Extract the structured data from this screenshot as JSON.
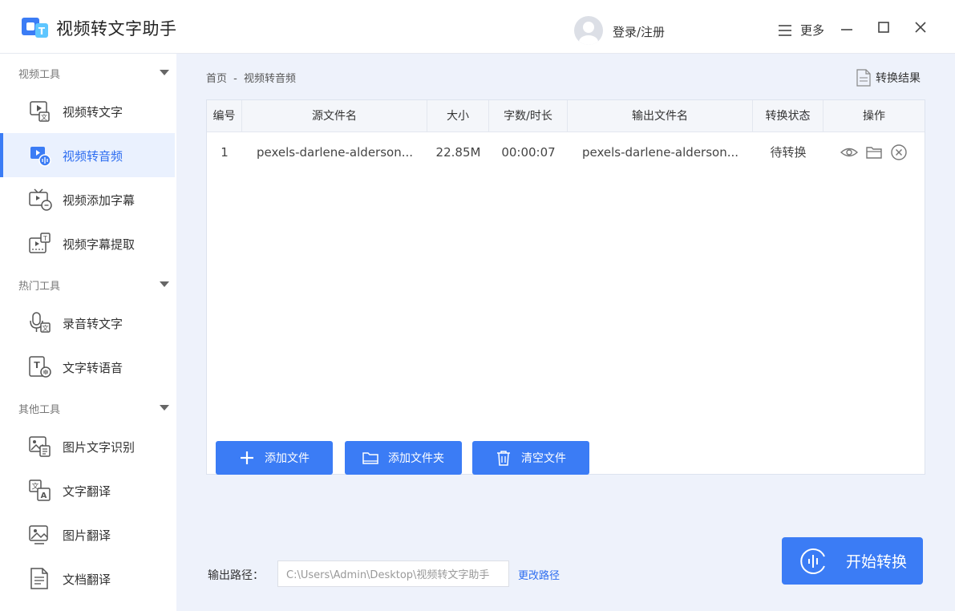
{
  "app": {
    "title": "视频转文字助手"
  },
  "header": {
    "login": "登录/注册",
    "menu": "更多"
  },
  "sidebar": {
    "groups": [
      {
        "label": "视频工具",
        "items": [
          {
            "label": "视频转文字"
          },
          {
            "label": "视频转音频"
          },
          {
            "label": "视频添加字幕"
          },
          {
            "label": "视频字幕提取"
          }
        ]
      },
      {
        "label": "热门工具",
        "items": [
          {
            "label": "录音转文字"
          },
          {
            "label": "文字转语音"
          }
        ]
      },
      {
        "label": "其他工具",
        "items": [
          {
            "label": "图片文字识别"
          },
          {
            "label": "文字翻译"
          },
          {
            "label": "图片翻译"
          },
          {
            "label": "文档翻译"
          }
        ]
      }
    ]
  },
  "breadcrumb": {
    "home": "首页",
    "sep": "-",
    "current": "视频转音频"
  },
  "result_link": "转换结果",
  "table": {
    "columns": [
      "编号",
      "源文件名",
      "大小",
      "字数/时长",
      "输出文件名",
      "转换状态",
      "操作"
    ],
    "rows": [
      {
        "num": "1",
        "source": "pexels-darlene-alderson...",
        "size": "22.85M",
        "duration": "00:00:07",
        "output": "pexels-darlene-alderson...",
        "status": "待转换"
      }
    ]
  },
  "buttons": {
    "add_file": "添加文件",
    "add_folder": "添加文件夹",
    "clear_files": "清空文件",
    "start": "开始转换"
  },
  "output": {
    "label": "输出路径：",
    "path": "C:\\Users\\Admin\\Desktop\\视频转文字助手",
    "change": "更改路径"
  },
  "colors": {
    "accent": "#3b7cf5",
    "active_bg": "#eaf1fe"
  }
}
